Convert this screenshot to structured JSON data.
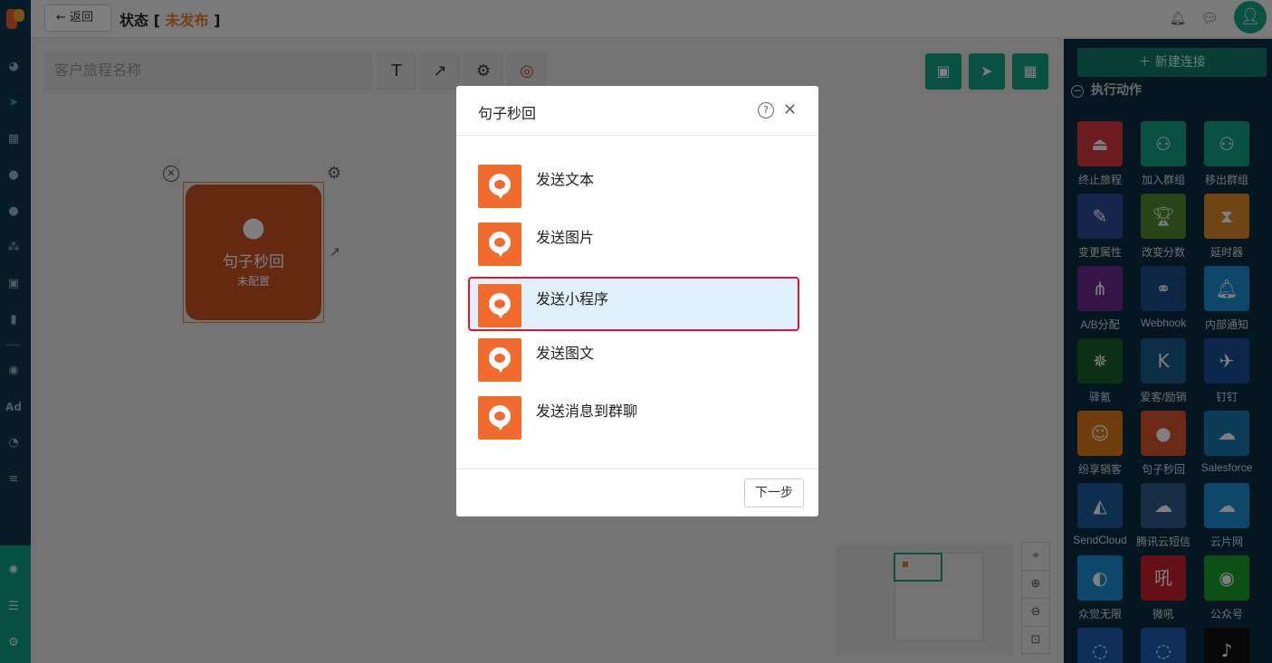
{
  "topbar": {
    "back_label": "返回",
    "status_prefix": "状态 [",
    "status_value": "未发布",
    "status_suffix": "]"
  },
  "canvas": {
    "name_placeholder": "客户旅程名称",
    "node": {
      "title": "句子秒回",
      "subtitle": "未配置"
    }
  },
  "right_panel": {
    "new_connection_label": "新建连接",
    "section_title": "执行动作",
    "actions": [
      {
        "label": "终止旅程",
        "color": "#d7393f",
        "icon": "stop-icon"
      },
      {
        "label": "加入群组",
        "color": "#13a385",
        "icon": "user-add-icon"
      },
      {
        "label": "移出群组",
        "color": "#13a385",
        "icon": "user-remove-icon"
      },
      {
        "label": "变更属性",
        "color": "#2c4f9a",
        "icon": "edit-icon"
      },
      {
        "label": "改变分数",
        "color": "#4f8a2c",
        "icon": "trophy-icon"
      },
      {
        "label": "延时器",
        "color": "#e08a2c",
        "icon": "hourglass-icon"
      },
      {
        "label": "A/B分配",
        "color": "#6a2c8f",
        "icon": "ab-split-icon"
      },
      {
        "label": "Webhook",
        "color": "#1a4f8a",
        "icon": "webhook-icon"
      },
      {
        "label": "内部通知",
        "color": "#1a8fd4",
        "icon": "bell-icon"
      },
      {
        "label": "驿氪",
        "color": "#1a5f2c",
        "icon": "spider-icon"
      },
      {
        "label": "爱客/励销",
        "color": "#1a5f8a",
        "icon": "k-logo-icon"
      },
      {
        "label": "钉钉",
        "color": "#1a4f9a",
        "icon": "dingtalk-icon"
      },
      {
        "label": "纷享销客",
        "color": "#e07a1a",
        "icon": "robot-icon"
      },
      {
        "label": "句子秒回",
        "color": "#d4542a",
        "icon": "chat-bubble-icon"
      },
      {
        "label": "Salesforce",
        "color": "#1a7ab0",
        "icon": "cloud-icon"
      },
      {
        "label": "SendCloud",
        "color": "#1a5f9a",
        "icon": "sendcloud-icon"
      },
      {
        "label": "腾讯云短信",
        "color": "#2c5f8a",
        "icon": "tencent-cloud-icon"
      },
      {
        "label": "云片网",
        "color": "#1a8fd4",
        "icon": "yunpian-icon"
      },
      {
        "label": "众觉无限",
        "color": "#1a8fd4",
        "icon": "zhongjue-icon"
      },
      {
        "label": "微吼",
        "color": "#c8202a",
        "icon": "weihou-icon"
      },
      {
        "label": "公众号",
        "color": "#1aa02c",
        "icon": "wechat-icon"
      },
      {
        "label": "",
        "color": "#1a5fb0",
        "icon": "chat-icon"
      },
      {
        "label": "",
        "color": "#1a5fb0",
        "icon": "chat-icon"
      },
      {
        "label": "",
        "color": "#111111",
        "icon": "tiktok-icon"
      }
    ]
  },
  "modal": {
    "title": "句子秒回",
    "options": [
      "发送文本",
      "发送图片",
      "发送小程序",
      "发送图文",
      "发送消息到群聊"
    ],
    "next_label": "下一步"
  },
  "colors": {
    "brand_green": "#13a385",
    "nav_dark": "#0d3b53",
    "accent_orange": "#e8822c",
    "option_icon": "#f26b2e",
    "selection_red": "#e0162b"
  }
}
